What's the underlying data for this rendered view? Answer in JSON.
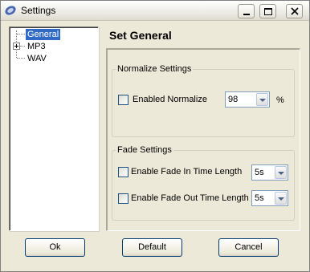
{
  "window": {
    "title": "Settings"
  },
  "tree": {
    "items": [
      {
        "label": "General"
      },
      {
        "label": "MP3"
      },
      {
        "label": "WAV"
      }
    ]
  },
  "panel": {
    "heading": "Set General",
    "normalize": {
      "group_label": "Normalize Settings",
      "enable_label": "Enabled Normalize",
      "value": "98",
      "unit": "%"
    },
    "fade": {
      "group_label": "Fade Settings",
      "fade_in_label": "Enable Fade In Time Length",
      "fade_in_value": "5s",
      "fade_out_label": "Enable Fade Out Time Length",
      "fade_out_value": "5s"
    }
  },
  "buttons": {
    "ok": "Ok",
    "default": "Default",
    "cancel": "Cancel"
  }
}
